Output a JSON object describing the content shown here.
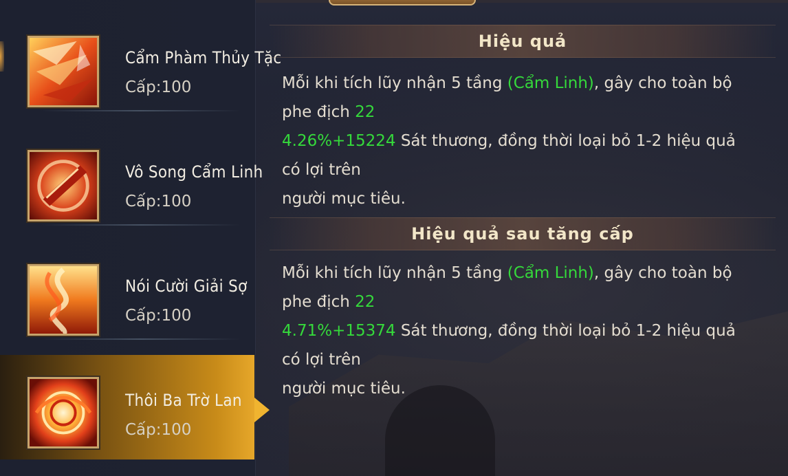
{
  "skills": [
    {
      "name": "Cẩm Phàm Thủy Tặc",
      "level": "Cấp:100",
      "icon": "red-claw-icon",
      "selected": false
    },
    {
      "name": "Vô Song Cẩm Linh",
      "level": "Cấp:100",
      "icon": "red-blade-icon",
      "selected": false
    },
    {
      "name": "Nói Cười Giải Sợ",
      "level": "Cấp:100",
      "icon": "fire-swirl-icon",
      "selected": false
    },
    {
      "name": "Thôi Ba Trờ Lan",
      "level": "Cấp:100",
      "icon": "fire-orb-icon",
      "selected": true
    }
  ],
  "effect": {
    "title": "Hiệu quả",
    "text_1": "Mỗi khi tích lũy nhận 5 tầng ",
    "tag": "(Cẩm Linh)",
    "text_2": ", gây cho toàn bộ phe địch ",
    "value_line1": "22",
    "value_line2": "4.26%+15224",
    "text_3": " Sát thương, đồng thời loại bỏ 1-2 hiệu quả có lợi trên",
    "text_4": "người mục tiêu."
  },
  "upgrade": {
    "title": "Hiệu quả sau tăng cấp",
    "text_1": "Mỗi khi tích lũy nhận 5 tầng ",
    "tag": "(Cẩm Linh)",
    "text_2": ", gây cho toàn bộ phe địch ",
    "value_line1": "22",
    "value_line2": "4.71%+15374",
    "text_3": " Sát thương, đồng thời loại bỏ 1-2 hiệu quả có lợi trên",
    "text_4": "người mục tiêu."
  },
  "colors": {
    "highlight": "#35d93b",
    "selected_accent": "#e6a72a",
    "icon_border": "#c7a36a"
  }
}
